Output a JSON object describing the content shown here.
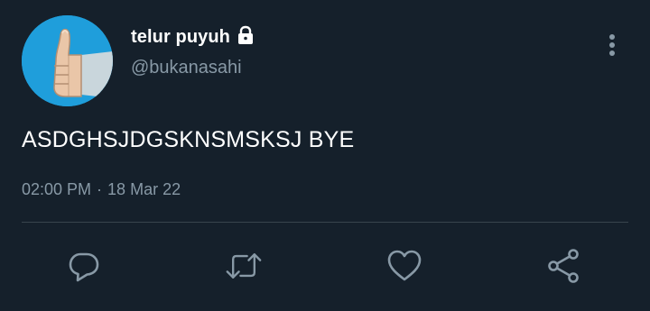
{
  "tweet": {
    "display_name": "telur puyuh",
    "handle": "@bukanasahi",
    "text": "ASDGHSJDGSKNSMSKSJ BYE",
    "time": "02:00 PM",
    "separator": "·",
    "date": "18 Mar 22",
    "protected": true
  },
  "icons": {
    "avatar": "thumbs-up-avatar",
    "lock": "lock-icon",
    "more": "more-vertical-icon",
    "reply": "reply-icon",
    "retweet": "retweet-icon",
    "like": "like-icon",
    "share": "share-icon"
  },
  "colors": {
    "background": "#15202b",
    "primary_text": "#ffffff",
    "secondary_text": "#8899a6",
    "divider": "#38444d",
    "avatar_bg": "#1f9edb"
  }
}
